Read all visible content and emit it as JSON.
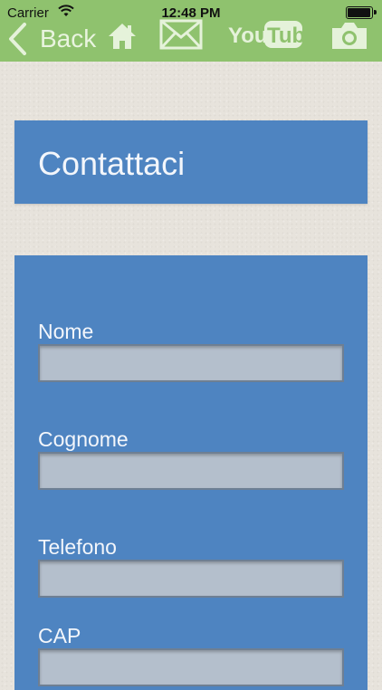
{
  "status_bar": {
    "carrier": "Carrier",
    "time": "12:48 PM"
  },
  "nav": {
    "back_label": "Back",
    "youtube_label_you": "You",
    "youtube_label_tube": "Tube"
  },
  "header": {
    "title": "Contattaci"
  },
  "form": {
    "fields": [
      {
        "label": "Nome",
        "value": ""
      },
      {
        "label": "Cognome",
        "value": ""
      },
      {
        "label": "Telefono",
        "value": ""
      },
      {
        "label": "CAP",
        "value": ""
      }
    ]
  },
  "colors": {
    "topbar": "#8fc26e",
    "panel": "#4e84c1",
    "input": "#b4bfcc",
    "background": "#e7e3dc"
  },
  "icons": [
    "wifi-icon",
    "battery-icon",
    "back-chevron-icon",
    "home-icon",
    "mail-icon",
    "youtube-icon",
    "camera-icon"
  ]
}
